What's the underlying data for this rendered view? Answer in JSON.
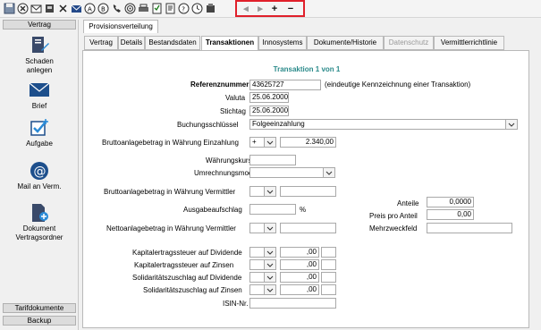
{
  "toolbar": {
    "icons": [
      "save-icon",
      "cancel-icon",
      "mail-icon",
      "user-icon",
      "close-icon",
      "envelope-icon",
      "font-icon",
      "attachment-icon",
      "phone-icon",
      "target-icon",
      "print-icon",
      "checklist-icon",
      "help-icon",
      "info-icon",
      "eraser-icon"
    ],
    "nav": {
      "plus": "+",
      "minus": "−",
      "prev": "◂",
      "next": "▸"
    }
  },
  "sidebar": {
    "header_top": "Vertrag",
    "items": [
      {
        "label": "Schaden anlegen"
      },
      {
        "label": "Brief"
      },
      {
        "label": "Aufgabe"
      },
      {
        "label": "Mail an Verm."
      },
      {
        "label": "Dokument Vertragsordner"
      }
    ],
    "header_bottom1": "Tarifdokumente",
    "header_bottom2": "Backup"
  },
  "top_tab": "Provisionsverteilung",
  "tabs": [
    "Vertrag",
    "Details",
    "Bestandsdaten",
    "Transaktionen",
    "Innosystems",
    "Dokumente/Historie",
    "Datenschutz",
    "Vermittlerrichtlinie"
  ],
  "form": {
    "title": "Transaktion 1 von 1",
    "referenz_label": "Referenznummer",
    "referenz_value": "43625727",
    "referenz_hint": "(eindeutige Kennzeichnung einer Transaktion)",
    "valuta_label": "Valuta",
    "valuta_value": "25.06.2000",
    "stichtag_label": "Stichtag",
    "stichtag_value": "25.06.2000",
    "buchung_label": "Buchungsschlüssel",
    "buchung_value": "Folgeeinzahlung",
    "brutto_einz_label": "Bruttoanlagebetrag in Währung Einzahlung",
    "brutto_einz_sign": "+",
    "brutto_einz_value": "2.340,00",
    "kurs_label": "Währungskurs",
    "modus_label": "Umrechnungsmodus",
    "brutto_verm_label": "Bruttoanlagebetrag in Währung Vermittler",
    "ausgabe_label": "Ausgabeaufschlag",
    "percent": "%",
    "netto_verm_label": "Nettoanlagebetrag in Währung Vermittler",
    "anteile_label": "Anteile",
    "anteile_value": "0,0000",
    "preis_label": "Preis pro Anteil",
    "preis_value": "0,00",
    "mehrzweck_label": "Mehrzweckfeld",
    "kapst_div_label": "Kapitalertragssteuer auf Dividende",
    "kapst_zins_label": "Kapitalertragssteuer auf Zinsen",
    "soli_div_label": "Solidaritätszuschlag auf Dividende",
    "soli_zins_label": "Solidaritätszuschlag auf Zinsen",
    "tax_value": ",00",
    "isin_label": "ISIN-Nr."
  }
}
